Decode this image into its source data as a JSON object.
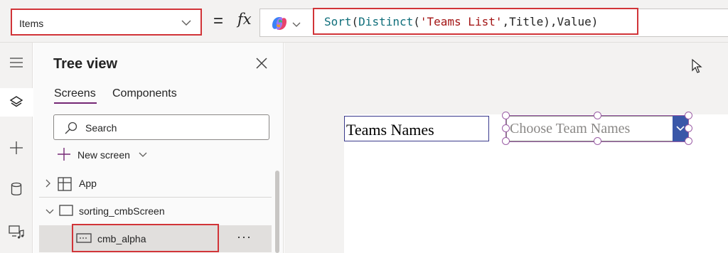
{
  "formula_bar": {
    "property": "Items",
    "equals": "=",
    "fx": "fx",
    "formula": {
      "fn_sort": "Sort",
      "p1": "(",
      "fn_distinct": "Distinct",
      "p2": "(",
      "str_list": "'Teams List'",
      "p3": ",",
      "id_title": "Title",
      "p4": "),",
      "id_value": "Value",
      "p5": ")"
    }
  },
  "rail": {
    "items": [
      "menu-icon",
      "layers-icon",
      "plus-icon",
      "database-icon",
      "media-icon"
    ]
  },
  "tree_view": {
    "title": "Tree view",
    "tabs": [
      "Screens",
      "Components"
    ],
    "search_placeholder": "Search",
    "new_screen": "New screen",
    "items": [
      {
        "label": "App"
      },
      {
        "label": "sorting_cmbScreen"
      },
      {
        "label": "cmb_alpha",
        "more": "···"
      }
    ]
  },
  "canvas": {
    "label_text": "Teams Names",
    "combo_placeholder": "Choose Team Names"
  },
  "colors": {
    "highlight": "#d13438",
    "selection": "#9b5ea6",
    "combo_button": "#3a57a8",
    "tab_accent": "#742774"
  }
}
